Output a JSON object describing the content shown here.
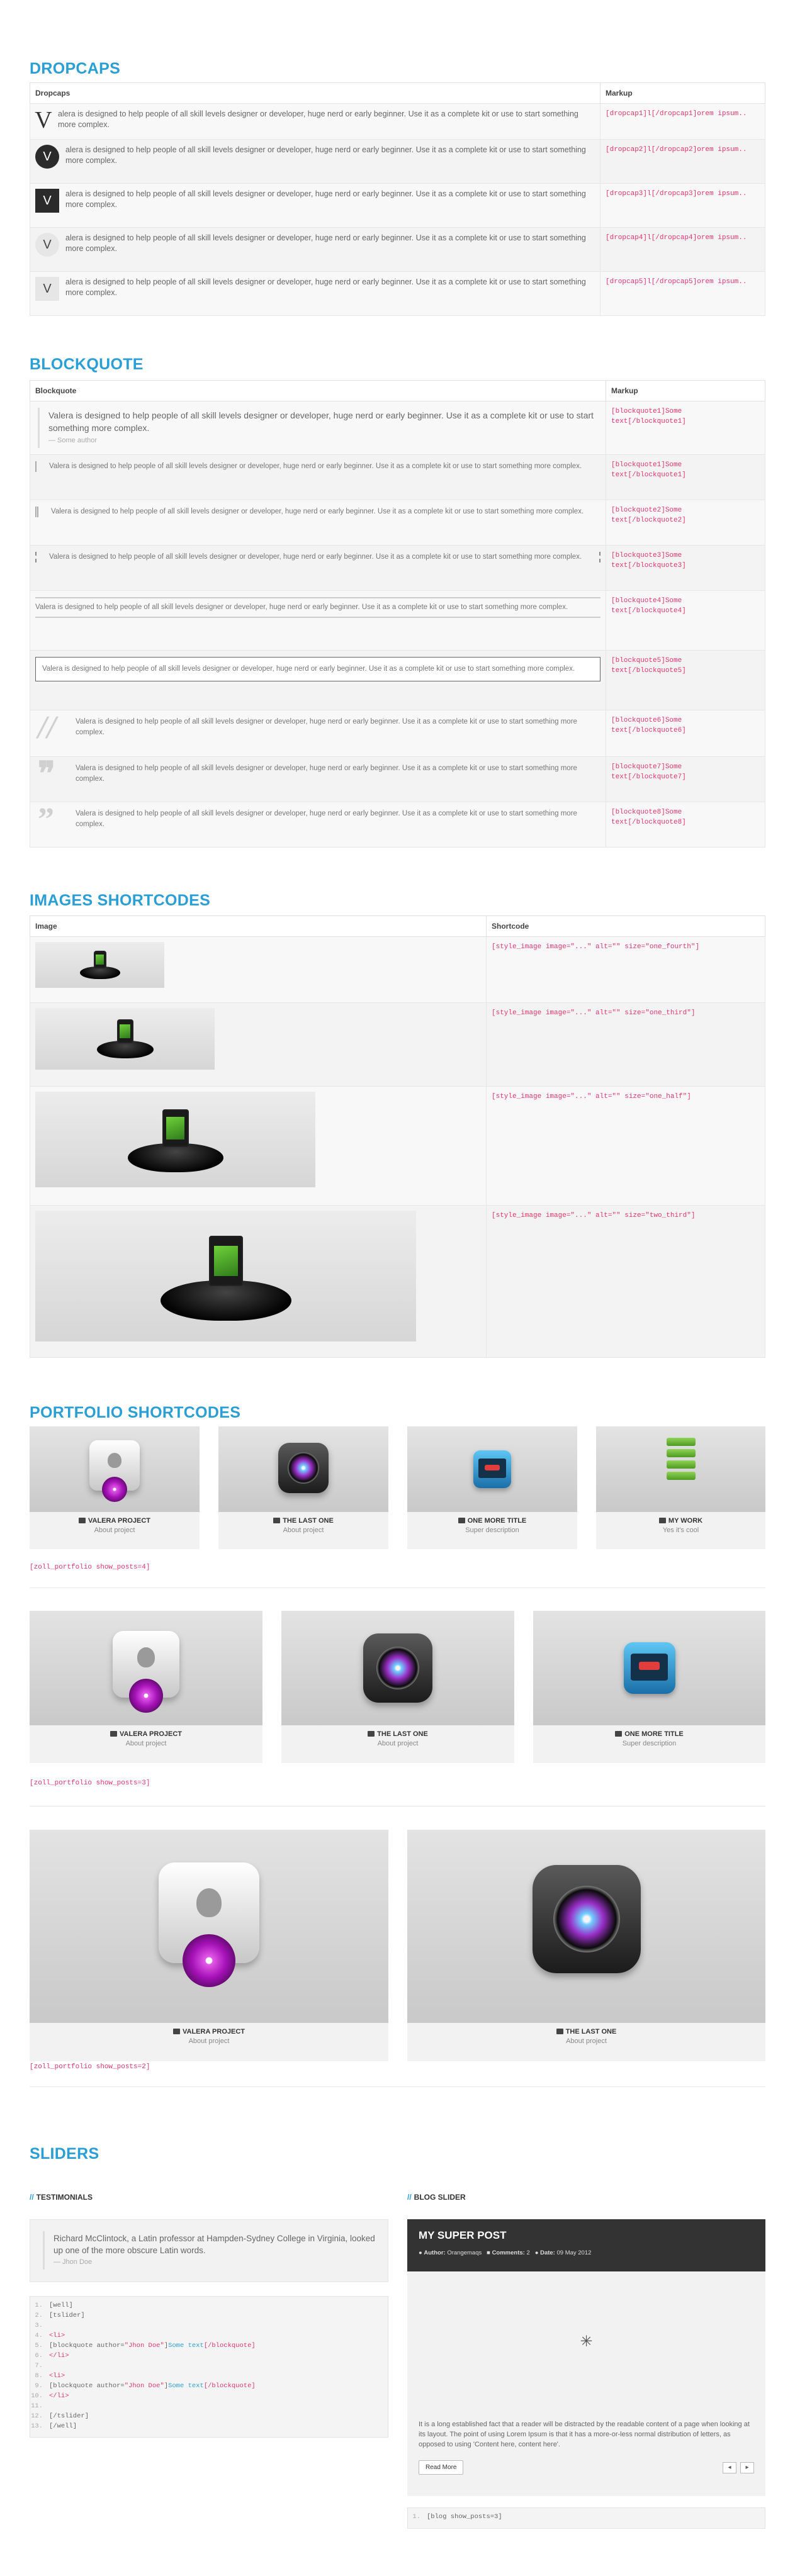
{
  "sections": {
    "dropcaps": "DROPCAPS",
    "blockquote": "BLOCKQUOTE",
    "images": "IMAGES SHORTCODES",
    "portfolio": "PORTFOLIO SHORTCODES",
    "sliders": "SLIDERS"
  },
  "dropcaps": {
    "col1": "Dropcaps",
    "col2": "Markup",
    "letter": "V",
    "text": "alera is designed to help people of all skill levels designer or developer, huge nerd or early beginner. Use it as a complete kit or use to start something more complex.",
    "rows": [
      {
        "code": "[dropcap1]l[/dropcap1]orem ipsum.."
      },
      {
        "code": "[dropcap2]l[/dropcap2]orem ipsum.."
      },
      {
        "code": "[dropcap3]l[/dropcap3]orem ipsum.."
      },
      {
        "code": "[dropcap4]l[/dropcap4]orem ipsum.."
      },
      {
        "code": "[dropcap5]l[/dropcap5]orem ipsum.."
      }
    ]
  },
  "blockquote": {
    "col1": "Blockquote",
    "col2": "Markup",
    "text": "Valera is designed to help people of all skill levels designer or developer, huge nerd or early beginner. Use it as a complete kit or use to start something more complex.",
    "author": "— Some author",
    "rows": [
      {
        "code": "[blockquote1]Some text[/blockquote1]"
      },
      {
        "code": "[blockquote1]Some text[/blockquote1]"
      },
      {
        "code": "[blockquote2]Some text[/blockquote2]"
      },
      {
        "code": "[blockquote3]Some text[/blockquote3]"
      },
      {
        "code": "[blockquote4]Some text[/blockquote4]"
      },
      {
        "code": "[blockquote5]Some text[/blockquote5]"
      },
      {
        "code": "[blockquote6]Some text[/blockquote6]"
      },
      {
        "code": "[blockquote7]Some text[/blockquote7]"
      },
      {
        "code": "[blockquote8]Some text[/blockquote8]"
      }
    ]
  },
  "images": {
    "col1": "Image",
    "col2": "Shortcode",
    "rows": [
      {
        "code": "[style_image image=\"...\" alt=\"\" size=\"one_fourth\"]"
      },
      {
        "code": "[style_image image=\"...\" alt=\"\" size=\"one_third\"]"
      },
      {
        "code": "[style_image image=\"...\" alt=\"\" size=\"one_half\"]"
      },
      {
        "code": "[style_image image=\"...\" alt=\"\" size=\"two_third\"]"
      }
    ]
  },
  "portfolio": {
    "items": [
      {
        "title": "VALERA PROJECT",
        "sub": "About project"
      },
      {
        "title": "THE LAST ONE",
        "sub": "About project"
      },
      {
        "title": "ONE MORE TITLE",
        "sub": "Super description"
      },
      {
        "title": "MY WORK",
        "sub": "Yes it's cool"
      }
    ],
    "code4": "[zoll_portfolio show_posts=4]",
    "code3": "[zoll_portfolio show_posts=3]",
    "code2": "[zoll_portfolio show_posts=2]"
  },
  "sliders": {
    "testimonials_title": "TESTIMONIALS",
    "blog_title": "BLOG SLIDER",
    "testimonial_text": "Richard McClintock, a Latin professor at Hampden-Sydney College in Virginia, looked up one of the more obscure Latin words.",
    "testimonial_author": "— Jhon Doe",
    "code_lines": [
      {
        "n": "1.",
        "parts": [
          {
            "t": "[well]",
            "c": "c"
          }
        ]
      },
      {
        "n": "2.",
        "parts": [
          {
            "t": "[tslider]",
            "c": "c"
          }
        ]
      },
      {
        "n": "3.",
        "parts": []
      },
      {
        "n": "4.",
        "parts": [
          {
            "t": "<li>",
            "c": "tag"
          }
        ]
      },
      {
        "n": "5.",
        "parts": [
          {
            "t": "[blockquote author=",
            "c": "c"
          },
          {
            "t": "\"Jhon Doe\"",
            "c": "tag"
          },
          {
            "t": "]",
            "c": "c"
          },
          {
            "t": "Some text",
            "c": "val"
          },
          {
            "t": "[/blockquote]",
            "c": "tag"
          }
        ]
      },
      {
        "n": "6.",
        "parts": [
          {
            "t": "</li>",
            "c": "tag"
          }
        ]
      },
      {
        "n": "7.",
        "parts": []
      },
      {
        "n": "8.",
        "parts": [
          {
            "t": "<li>",
            "c": "tag"
          }
        ]
      },
      {
        "n": "9.",
        "parts": [
          {
            "t": "[blockquote author=",
            "c": "c"
          },
          {
            "t": "\"Jhon Doe\"",
            "c": "tag"
          },
          {
            "t": "]",
            "c": "c"
          },
          {
            "t": "Some text",
            "c": "val"
          },
          {
            "t": "[/blockquote]",
            "c": "tag"
          }
        ]
      },
      {
        "n": "10.",
        "parts": [
          {
            "t": "</li>",
            "c": "tag"
          }
        ]
      },
      {
        "n": "11.",
        "parts": []
      },
      {
        "n": "12.",
        "parts": [
          {
            "t": "[/tslider]",
            "c": "c"
          }
        ]
      },
      {
        "n": "13.",
        "parts": [
          {
            "t": "[/well]",
            "c": "c"
          }
        ]
      }
    ],
    "post_title": "MY SUPER POST",
    "author_label": "Author:",
    "author": "Orangemaqs",
    "comments_label": "Comments:",
    "comments": "2",
    "date_label": "Date:",
    "date": "09 May 2012",
    "post_text": "It is a long established fact that a reader will be distracted by the readable content of a page when looking at its layout. The point of using Lorem Ipsum is that it has a more-or-less normal distribution of letters, as opposed to using 'Content here, content here'.",
    "read_more": "Read More",
    "prev": "◂",
    "next": "▸",
    "blog_code_n": "1.",
    "blog_code": "[blog show_posts=3]"
  },
  "colors": {
    "accent": "#2a9fd6",
    "code": "#e0356b",
    "dark_header": "#333333"
  }
}
